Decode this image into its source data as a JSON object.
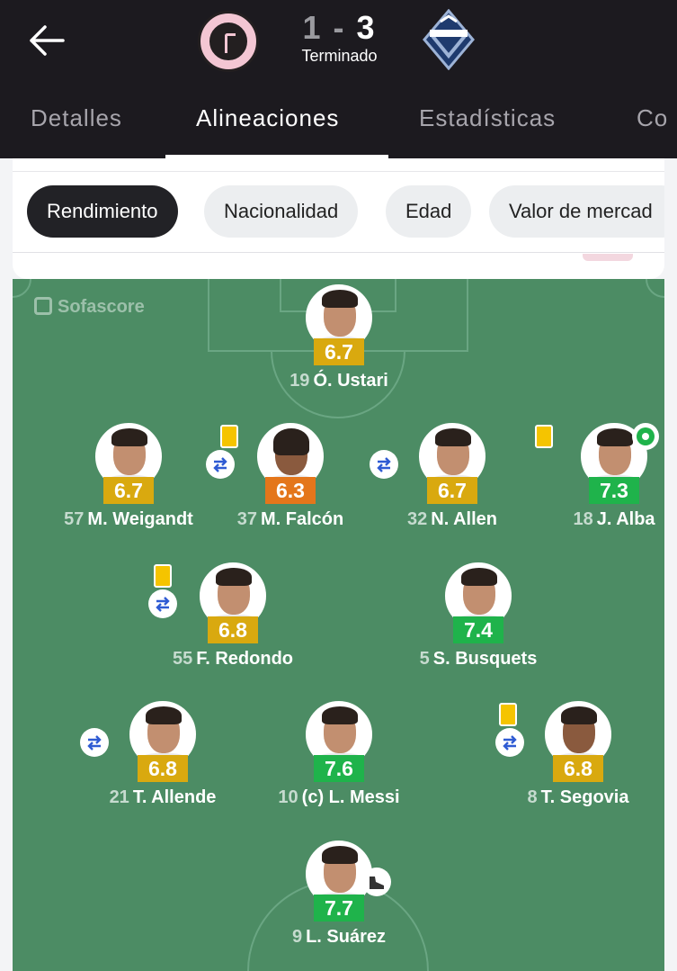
{
  "header": {
    "back_icon": "back-arrow-icon",
    "home_crest_icon": "inter-miami-crest-icon",
    "away_crest_icon": "vancouver-whitecaps-crest-icon",
    "score_home": "1",
    "score_sep": "-",
    "score_away": "3",
    "status": "Terminado"
  },
  "tabs": [
    {
      "label": "Detalles"
    },
    {
      "label": "Alineaciones"
    },
    {
      "label": "Estadísticas"
    },
    {
      "label": "Co"
    }
  ],
  "filters": [
    {
      "label": "Rendimiento"
    },
    {
      "label": "Nacionalidad"
    },
    {
      "label": "Edad"
    },
    {
      "label": "Valor de mercad"
    }
  ],
  "pitch": {
    "watermark": "Sofascore",
    "players": [
      {
        "number": "19",
        "name": "Ó. Ustari",
        "rating": "6.7",
        "rating_color": "#d9a90f"
      },
      {
        "number": "57",
        "name": "M. Weigandt",
        "rating": "6.7",
        "rating_color": "#d9a90f"
      },
      {
        "number": "37",
        "name": "M. Falcón",
        "rating": "6.3",
        "rating_color": "#e4761b"
      },
      {
        "number": "32",
        "name": "N. Allen",
        "rating": "6.7",
        "rating_color": "#d9a90f"
      },
      {
        "number": "18",
        "name": "J. Alba",
        "rating": "7.3",
        "rating_color": "#1fb34b"
      },
      {
        "number": "55",
        "name": "F. Redondo",
        "rating": "6.8",
        "rating_color": "#d9a90f"
      },
      {
        "number": "5",
        "name": "S. Busquets",
        "rating": "7.4",
        "rating_color": "#1fb34b"
      },
      {
        "number": "21",
        "name": "T. Allende",
        "rating": "6.8",
        "rating_color": "#d9a90f"
      },
      {
        "number": "10",
        "name": "(c) L. Messi",
        "rating": "7.6",
        "rating_color": "#1fb34b"
      },
      {
        "number": "8",
        "name": "T. Segovia",
        "rating": "6.8",
        "rating_color": "#d9a90f"
      },
      {
        "number": "9",
        "name": "L. Suárez",
        "rating": "7.7",
        "rating_color": "#1fb34b"
      }
    ]
  }
}
